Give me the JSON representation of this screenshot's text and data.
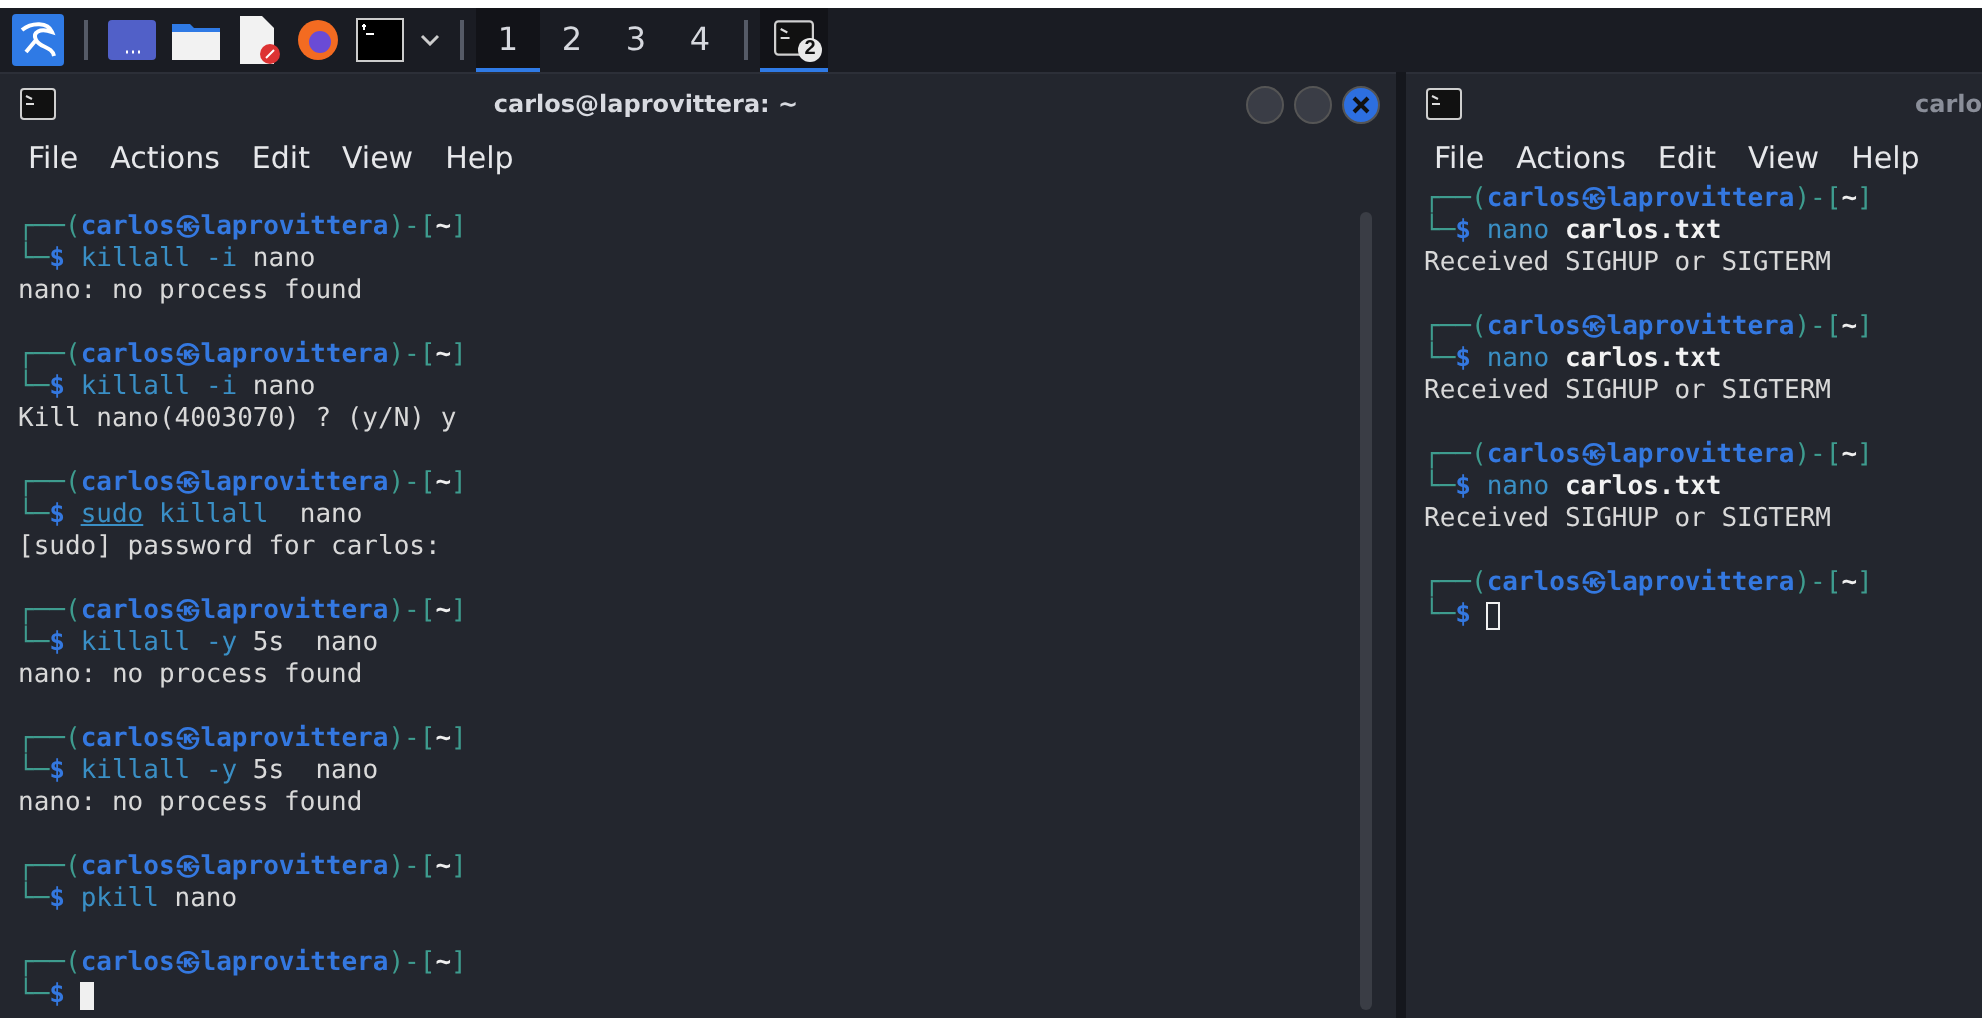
{
  "taskbar": {
    "launchers": [
      {
        "kind": "menu"
      },
      {
        "kind": "desktop"
      },
      {
        "kind": "files"
      },
      {
        "kind": "editor"
      },
      {
        "kind": "browser"
      },
      {
        "kind": "terminal"
      },
      {
        "kind": "dropdown"
      }
    ],
    "workspaces": [
      {
        "label": "1",
        "selected": true
      },
      {
        "label": "2",
        "selected": false
      },
      {
        "label": "3",
        "selected": false
      },
      {
        "label": "4",
        "selected": false
      }
    ],
    "task": {
      "badge": "2",
      "selected": true
    }
  },
  "windows": [
    {
      "title": "carlos@laprovittera: ~",
      "focused": true,
      "controls": [
        {
          "kind": "minimize"
        },
        {
          "kind": "maximize"
        },
        {
          "kind": "close"
        }
      ],
      "menu": [
        "File",
        "Actions",
        "Edit",
        "View",
        "Help"
      ],
      "blocks": [
        {
          "open": "┌──(",
          "user": "carlos",
          "sep": "㉿",
          "host": "laprovittera",
          "mid": ")-[",
          "dir": "~",
          "close": "]",
          "corner": "└─",
          "dollar": "$",
          "command": [
            {
              "kind": "command",
              "text": "killall"
            },
            {
              "kind": "option",
              "text": "-i"
            },
            {
              "kind": "arg",
              "text": "nano"
            }
          ],
          "output": [
            "nano: no process found"
          ]
        },
        {
          "open": "┌──(",
          "user": "carlos",
          "sep": "㉿",
          "host": "laprovittera",
          "mid": ")-[",
          "dir": "~",
          "close": "]",
          "corner": "└─",
          "dollar": "$",
          "command": [
            {
              "kind": "command",
              "text": "killall"
            },
            {
              "kind": "option",
              "text": "-i"
            },
            {
              "kind": "arg",
              "text": "nano"
            }
          ],
          "output": [
            "Kill nano(4003070) ? (y/N) y"
          ]
        },
        {
          "open": "┌──(",
          "user": "carlos",
          "sep": "㉿",
          "host": "laprovittera",
          "mid": ")-[",
          "dir": "~",
          "close": "]",
          "corner": "└─",
          "dollar": "$",
          "command": [
            {
              "kind": "sudo",
              "text": "sudo"
            },
            {
              "kind": "command",
              "text": "killall "
            },
            {
              "kind": "arg",
              "text": "nano"
            }
          ],
          "output": [
            "[sudo] password for carlos:"
          ]
        },
        {
          "open": "┌──(",
          "user": "carlos",
          "sep": "㉿",
          "host": "laprovittera",
          "mid": ")-[",
          "dir": "~",
          "close": "]",
          "corner": "└─",
          "dollar": "$",
          "command": [
            {
              "kind": "command",
              "text": "killall"
            },
            {
              "kind": "option",
              "text": "-y"
            },
            {
              "kind": "arg",
              "text": "5s "
            },
            {
              "kind": "arg",
              "text": "nano"
            }
          ],
          "output": [
            "nano: no process found"
          ]
        },
        {
          "open": "┌──(",
          "user": "carlos",
          "sep": "㉿",
          "host": "laprovittera",
          "mid": ")-[",
          "dir": "~",
          "close": "]",
          "corner": "└─",
          "dollar": "$",
          "command": [
            {
              "kind": "command",
              "text": "killall"
            },
            {
              "kind": "option",
              "text": "-y"
            },
            {
              "kind": "arg",
              "text": "5s "
            },
            {
              "kind": "arg",
              "text": "nano"
            }
          ],
          "output": [
            "nano: no process found"
          ]
        },
        {
          "open": "┌──(",
          "user": "carlos",
          "sep": "㉿",
          "host": "laprovittera",
          "mid": ")-[",
          "dir": "~",
          "close": "]",
          "corner": "└─",
          "dollar": "$",
          "command": [
            {
              "kind": "command",
              "text": "pkill"
            },
            {
              "kind": "arg",
              "text": "nano"
            }
          ]
        },
        {
          "open": "┌──(",
          "user": "carlos",
          "sep": "㉿",
          "host": "laprovittera",
          "mid": ")-[",
          "dir": "~",
          "close": "]",
          "corner": "└─",
          "dollar": "$",
          "cursor": true
        }
      ]
    },
    {
      "title": "carlo",
      "focused": false,
      "menu": [
        "File",
        "Actions",
        "Edit",
        "View",
        "Help"
      ],
      "blocks": [
        {
          "open": "┌──(",
          "user": "carlos",
          "sep": "㉿",
          "host": "laprovittera",
          "mid": ")-[",
          "dir": "~",
          "close": "]",
          "corner": "└─",
          "dollar": "$",
          "command": [
            {
              "kind": "command",
              "text": "nano"
            },
            {
              "kind": "path",
              "text": "carlos.txt"
            }
          ],
          "output": [
            "Received SIGHUP or SIGTERM"
          ]
        },
        {
          "open": "┌──(",
          "user": "carlos",
          "sep": "㉿",
          "host": "laprovittera",
          "mid": ")-[",
          "dir": "~",
          "close": "]",
          "corner": "└─",
          "dollar": "$",
          "command": [
            {
              "kind": "command",
              "text": "nano"
            },
            {
              "kind": "path",
              "text": "carlos.txt"
            }
          ],
          "output": [
            "Received SIGHUP or SIGTERM"
          ]
        },
        {
          "open": "┌──(",
          "user": "carlos",
          "sep": "㉿",
          "host": "laprovittera",
          "mid": ")-[",
          "dir": "~",
          "close": "]",
          "corner": "└─",
          "dollar": "$",
          "command": [
            {
              "kind": "command",
              "text": "nano"
            },
            {
              "kind": "path",
              "text": "carlos.txt"
            }
          ],
          "output": [
            "Received SIGHUP or SIGTERM"
          ]
        },
        {
          "open": "┌──(",
          "user": "carlos",
          "sep": "㉿",
          "host": "laprovittera",
          "mid": ")-[",
          "dir": "~",
          "close": "]",
          "corner": "└─",
          "dollar": "$",
          "cursor": true
        }
      ]
    }
  ]
}
